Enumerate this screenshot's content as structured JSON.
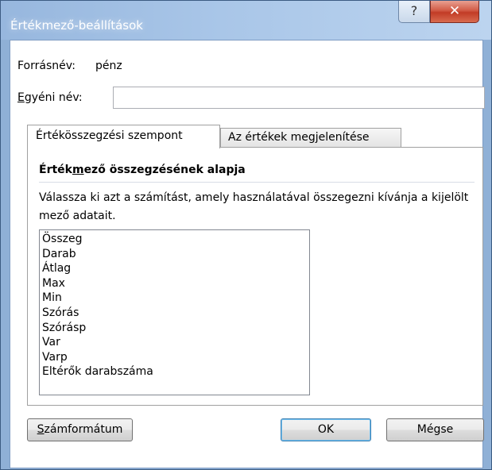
{
  "window": {
    "title": "Értékmező-beállítások",
    "help_glyph": "?",
    "close_glyph": "✕"
  },
  "source": {
    "label": "Forrásnév:",
    "value": "pénz"
  },
  "custom_name": {
    "label_first_letter": "E",
    "label_rest": "gyéni név:",
    "value": ""
  },
  "tabs": [
    {
      "label": "Értékösszegzési szempont",
      "active": true
    },
    {
      "label": "Az értékek megjelenítése",
      "active": false
    }
  ],
  "summarize": {
    "title_before": "Érték",
    "title_underlined": "m",
    "title_after": "ező összegzésének alapja",
    "description": "Válassza ki azt a számítást, amely használatával összegezni kívánja a kijelölt mező adatait.",
    "items": [
      "Összeg",
      "Darab",
      "Átlag",
      "Max",
      "Min",
      "Szórás",
      "Szórásp",
      "Var",
      "Varp",
      "Eltérők darabszáma"
    ]
  },
  "buttons": {
    "number_format_first": "S",
    "number_format_rest": "zámformátum",
    "ok": "OK",
    "cancel": "Mégse"
  }
}
